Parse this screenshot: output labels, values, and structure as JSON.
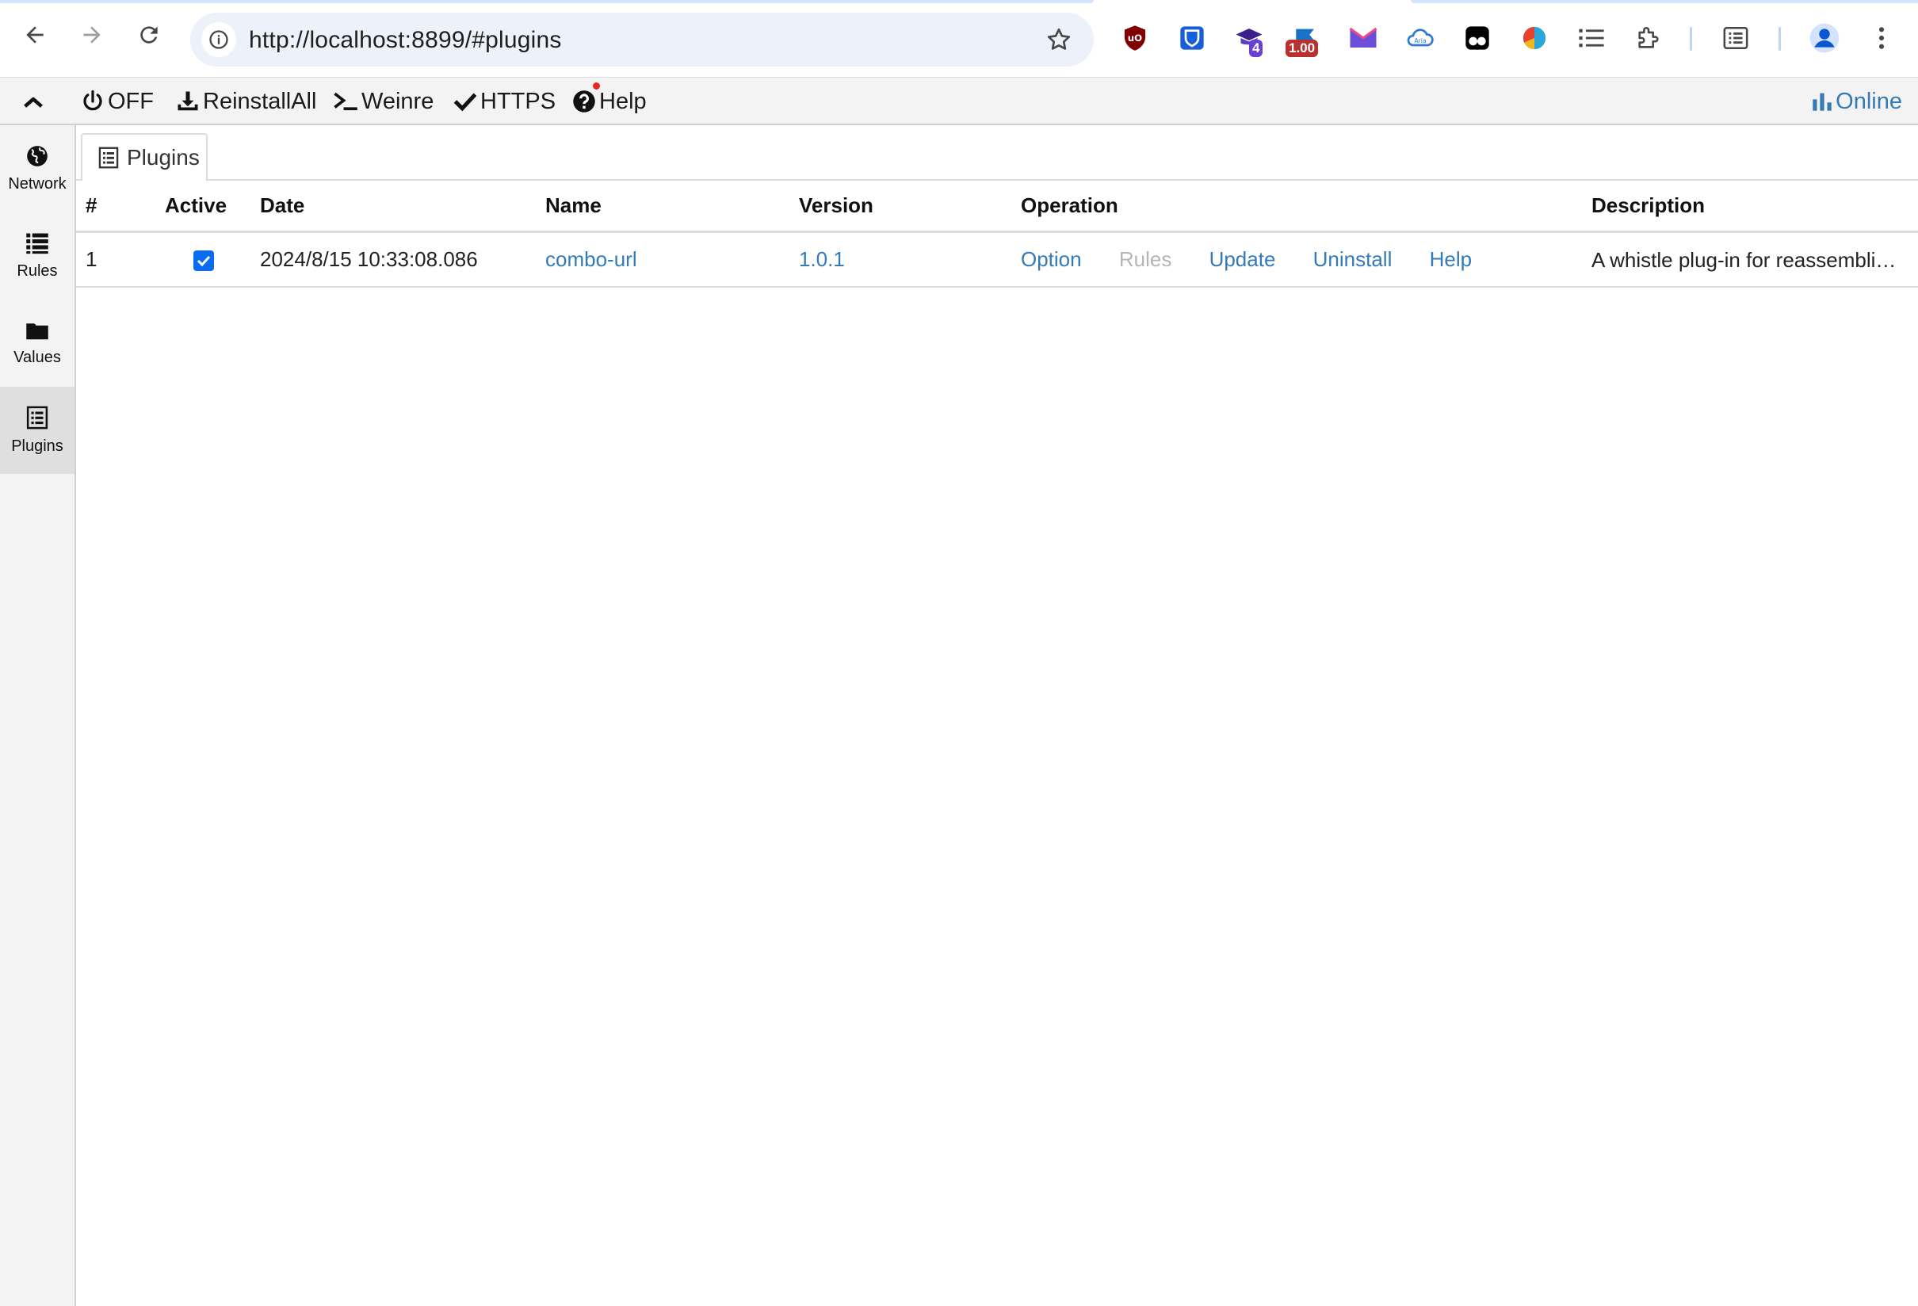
{
  "browser": {
    "url": "http://localhost:8899/#plugins",
    "extensions": [
      {
        "name": "ublock-icon",
        "badge": ""
      },
      {
        "name": "bitwarden-icon",
        "badge": ""
      },
      {
        "name": "graduation-cap-icon",
        "badge": "4"
      },
      {
        "name": "flag-icon",
        "badge": "1.00"
      },
      {
        "name": "mail-icon",
        "badge": ""
      },
      {
        "name": "aria-cloud-icon",
        "badge": ""
      },
      {
        "name": "tampermonkey-icon",
        "badge": ""
      },
      {
        "name": "color-ball-icon",
        "badge": ""
      },
      {
        "name": "list-icon",
        "badge": ""
      },
      {
        "name": "puzzle-icon",
        "badge": ""
      }
    ]
  },
  "toolbar": {
    "off": "OFF",
    "reinstall_all": "ReinstallAll",
    "weinre": "Weinre",
    "https": "HTTPS",
    "help": "Help",
    "online": "Online"
  },
  "sidebar": {
    "items": [
      {
        "label": "Network",
        "icon": "globe-icon"
      },
      {
        "label": "Rules",
        "icon": "list-icon"
      },
      {
        "label": "Values",
        "icon": "folder-icon"
      },
      {
        "label": "Plugins",
        "icon": "plugin-list-icon"
      }
    ]
  },
  "main": {
    "tab_label": "Plugins",
    "columns": [
      "#",
      "Active",
      "Date",
      "Name",
      "Version",
      "Operation",
      "Description"
    ],
    "rows": [
      {
        "index": "1",
        "active": true,
        "date": "2024/8/15 10:33:08.086",
        "name": "combo-url",
        "version": "1.0.1",
        "operations": {
          "option": "Option",
          "rules": "Rules",
          "update": "Update",
          "uninstall": "Uninstall",
          "help": "Help"
        },
        "description": "A whistle plug-in for reassembli…"
      }
    ]
  },
  "colors": {
    "link": "#337ab7",
    "checkbox": "#0b6cf0",
    "help_dot": "#e8281c"
  }
}
